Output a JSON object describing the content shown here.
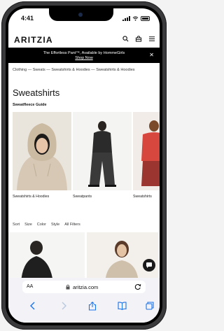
{
  "status": {
    "time": "4:41"
  },
  "brand": {
    "logo": "ARITZIA"
  },
  "header_icons": [
    "search-icon",
    "shopping-bag-icon",
    "menu-icon"
  ],
  "promo": {
    "text": "The Effortless Pant™, Available by HommeGirls",
    "link": "Shop Now"
  },
  "breadcrumb": "Clothing — Sweats — Sweatshirts & Hoodies — Sweatshirts & Hoodies",
  "page": {
    "title": "Sweatshirts",
    "subtitle": "Sweatfleece Guide"
  },
  "carousel": [
    {
      "label": "Sweatshirts & Hoodies"
    },
    {
      "label": "Sweatpants"
    },
    {
      "label": "Sweatshirts"
    }
  ],
  "filters": [
    "Sort",
    "Size",
    "Color",
    "Style",
    "All Filters"
  ],
  "browser": {
    "aa": "AA",
    "url": "aritzia.com"
  },
  "colors": {
    "promo_bg": "#000000",
    "browser_bar": "#f2f2f7",
    "tint": "#1a73e8"
  }
}
